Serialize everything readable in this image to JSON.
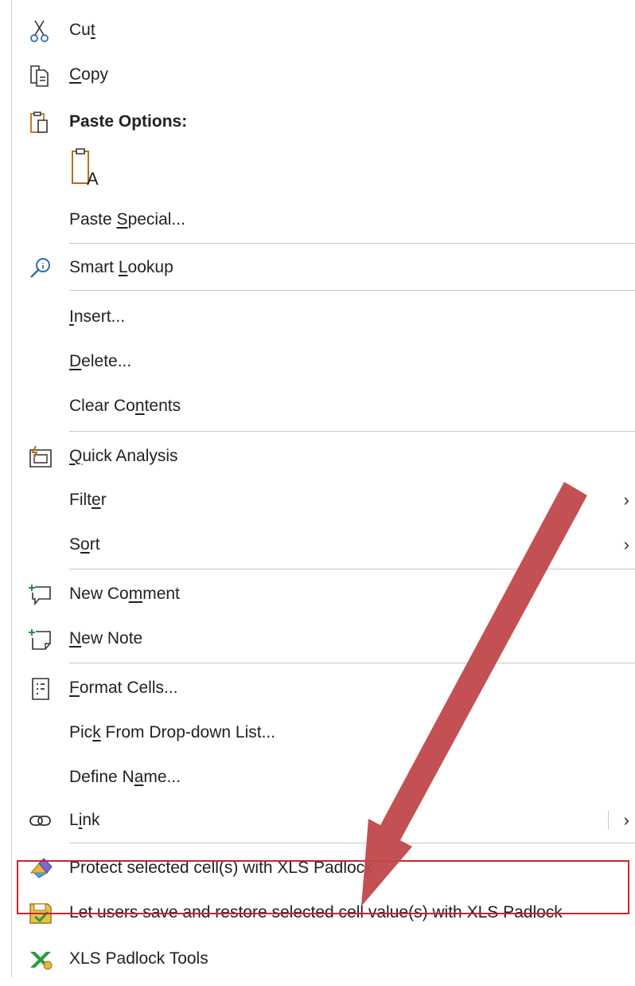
{
  "menu": {
    "cut": {
      "pre": "Cu",
      "key": "t",
      "post": ""
    },
    "copy": {
      "pre": "",
      "key": "C",
      "post": "opy"
    },
    "paste_options": "Paste Options:",
    "paste_special": {
      "pre": "Paste ",
      "key": "S",
      "post": "pecial..."
    },
    "smart_lookup": {
      "pre": "Smart ",
      "key": "L",
      "post": "ookup"
    },
    "insert": {
      "pre": "",
      "key": "I",
      "post": "nsert..."
    },
    "delete": {
      "pre": "",
      "key": "D",
      "post": "elete..."
    },
    "clear_contents": {
      "pre": "Clear Co",
      "key": "n",
      "post": "tents"
    },
    "quick_analysis": {
      "pre": "",
      "key": "Q",
      "post": "uick Analysis"
    },
    "filter": {
      "pre": "Filt",
      "key": "e",
      "post": "r"
    },
    "sort": {
      "pre": "S",
      "key": "o",
      "post": "rt"
    },
    "new_comment": {
      "pre": "New Co",
      "key": "m",
      "post": "ment"
    },
    "new_note": {
      "pre": "",
      "key": "N",
      "post": "ew Note"
    },
    "format_cells": {
      "pre": "",
      "key": "F",
      "post": "ormat Cells..."
    },
    "pick_from_list": {
      "pre": "Pic",
      "key": "k",
      "post": " From Drop-down List..."
    },
    "define_name": {
      "pre": "Define N",
      "key": "a",
      "post": "me..."
    },
    "link": {
      "pre": "L",
      "key": "i",
      "post": "nk"
    },
    "protect_cells": "Protect selected cell(s) with XLS Padlock",
    "save_restore": "Let users save and restore selected cell value(s) with XLS Padlock",
    "padlock_tools": "XLS Padlock Tools"
  },
  "icons": {
    "cut": "scissors-icon",
    "copy": "copy-icon",
    "paste": "clipboard-icon",
    "paste_keep_text": "paste-text-only-icon",
    "smart_lookup": "search-info-icon",
    "quick_analysis": "quick-analysis-icon",
    "new_comment": "new-comment-icon",
    "new_note": "new-note-icon",
    "format_cells": "format-cells-icon",
    "link": "link-icon",
    "protect": "xls-padlock-protect-icon",
    "save_restore": "xls-padlock-save-restore-icon",
    "tools": "xls-padlock-tools-icon",
    "submenu": "chevron-right-icon"
  },
  "colors": {
    "highlight_border": "#c9252c",
    "arrow": "#c0474a",
    "separator": "#c8c8c8",
    "text": "#222222"
  }
}
